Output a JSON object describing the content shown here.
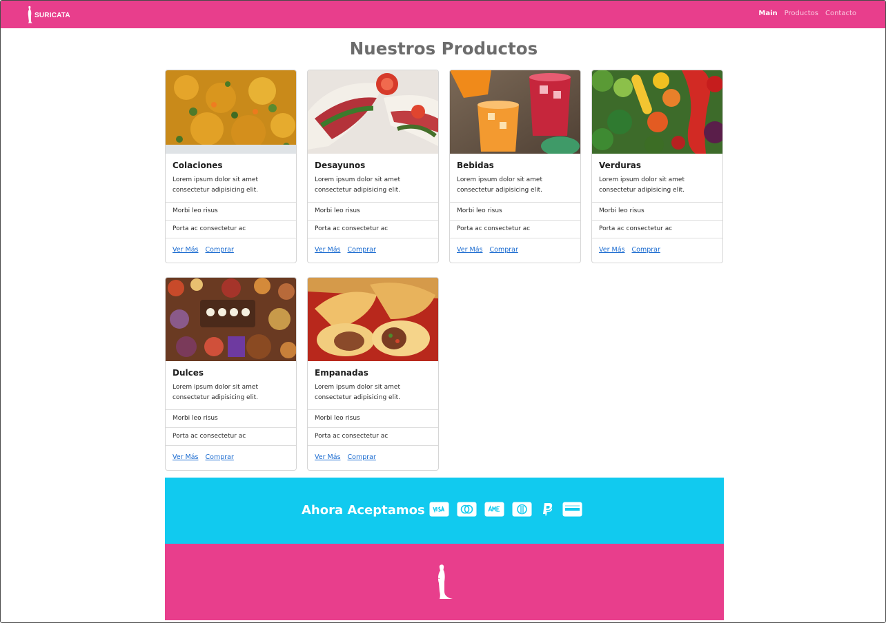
{
  "navbar": {
    "brand": "SURICATA",
    "links": [
      {
        "label": "Main",
        "active": true
      },
      {
        "label": "Productos",
        "active": false
      },
      {
        "label": "Contacto",
        "active": false
      }
    ]
  },
  "page_title": "Nuestros Productos",
  "products": [
    {
      "title": "Colaciones",
      "text": "Lorem ipsum dolor sit amet consectetur adipisicing elit.",
      "item1": "Morbi leo risus",
      "item2": "Porta ac consectetur ac",
      "link1": "Ver Más",
      "link2": "Comprar",
      "image": "colaciones-image"
    },
    {
      "title": "Desayunos",
      "text": "Lorem ipsum dolor sit amet consectetur adipisicing elit.",
      "item1": "Morbi leo risus",
      "item2": "Porta ac consectetur ac",
      "link1": "Ver Más",
      "link2": "Comprar",
      "image": "desayunos-image"
    },
    {
      "title": "Bebidas",
      "text": "Lorem ipsum dolor sit amet consectetur adipisicing elit.",
      "item1": "Morbi leo risus",
      "item2": "Porta ac consectetur ac",
      "link1": "Ver Más",
      "link2": "Comprar",
      "image": "bebidas-image"
    },
    {
      "title": "Verduras",
      "text": "Lorem ipsum dolor sit amet consectetur adipisicing elit.",
      "item1": "Morbi leo risus",
      "item2": "Porta ac consectetur ac",
      "link1": "Ver Más",
      "link2": "Comprar",
      "image": "verduras-image"
    },
    {
      "title": "Dulces",
      "text": "Lorem ipsum dolor sit amet consectetur adipisicing elit.",
      "item1": "Morbi leo risus",
      "item2": "Porta ac consectetur ac",
      "link1": "Ver Más",
      "link2": "Comprar",
      "image": "dulces-image"
    },
    {
      "title": "Empanadas",
      "text": "Lorem ipsum dolor sit amet consectetur adipisicing elit.",
      "item1": "Morbi leo risus",
      "item2": "Porta ac consectetur ac",
      "link1": "Ver Más",
      "link2": "Comprar",
      "image": "empanadas-image"
    }
  ],
  "payments": {
    "label": "Ahora Aceptamos",
    "icons": [
      "visa-icon",
      "mastercard-icon",
      "amex-icon",
      "diners-icon",
      "paypal-icon",
      "card-icon"
    ]
  },
  "colors": {
    "brand_pink": "#e83e8c",
    "payments_cyan": "#11caef",
    "link_blue": "#1a6bd0",
    "title_gray": "#6c6c6c"
  }
}
